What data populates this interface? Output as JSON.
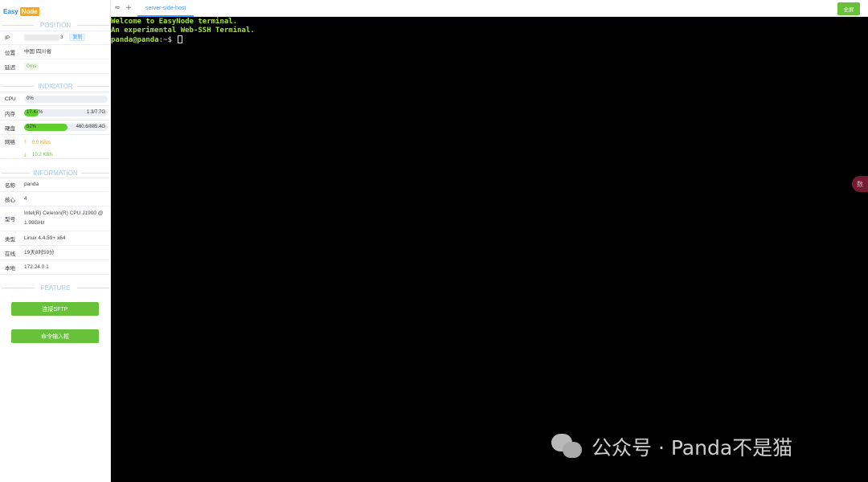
{
  "logo": {
    "part1": "Easy",
    "part2": "Node"
  },
  "position": {
    "title": "POSITION",
    "ip_label": "IP",
    "ip_tail": "3",
    "copy_label": "复制",
    "location_label": "位置",
    "location_value": "中国 四川省",
    "latency_label": "延迟",
    "latency_value": "0ms"
  },
  "indicator": {
    "title": "INDICATOR",
    "cpu_label": "CPU",
    "cpu_pct": "0%",
    "cpu_fraction": 0.0,
    "mem_label": "内存",
    "mem_pct": "17.47%",
    "mem_amount": "1.3/7.7G",
    "mem_fraction": 0.1747,
    "disk_label": "硬盘",
    "disk_pct": "52%",
    "disk_amount": "460.6/885.4G",
    "disk_fraction": 0.52,
    "net_label": "网络",
    "net_up": "0.0 KB/s",
    "net_down": "10.2 KB/s"
  },
  "information": {
    "title": "INFORMATION",
    "name_label": "名称",
    "name_value": "panda",
    "cores_label": "核心",
    "cores_value": "4",
    "model_label": "型号",
    "model_value": "Intel(R) Celeron(R) CPU J1900 @ 1.99GHz",
    "type_label": "类型",
    "type_value": "Linux 4.4.59+ x64",
    "online_label": "在线",
    "online_value": "19天8时59分",
    "local_label": "本地",
    "local_value": "172.24.0.1"
  },
  "feature": {
    "title": "FEATURE",
    "sftp_label": "连接SFTP",
    "cmd_label": "命令输入框"
  },
  "tabbar": {
    "toggle_icon": "≈",
    "add_icon": "+",
    "active_tab": "server-side-host",
    "fullscreen_label": "全屏"
  },
  "terminal": {
    "line1": "Welcome to EasyNode terminal.",
    "line2": "An experimental Web-SSH Terminal.",
    "prompt_user": "panda@panda",
    "prompt_rest": ":~$ "
  },
  "float_label": "数",
  "watermark": "公众号 · Panda不是猫",
  "colors": {
    "accent_blue": "#409eff",
    "accent_green": "#67c23a",
    "terminal_green": "#a6e22e",
    "bar_fill": "#5fd02c"
  }
}
